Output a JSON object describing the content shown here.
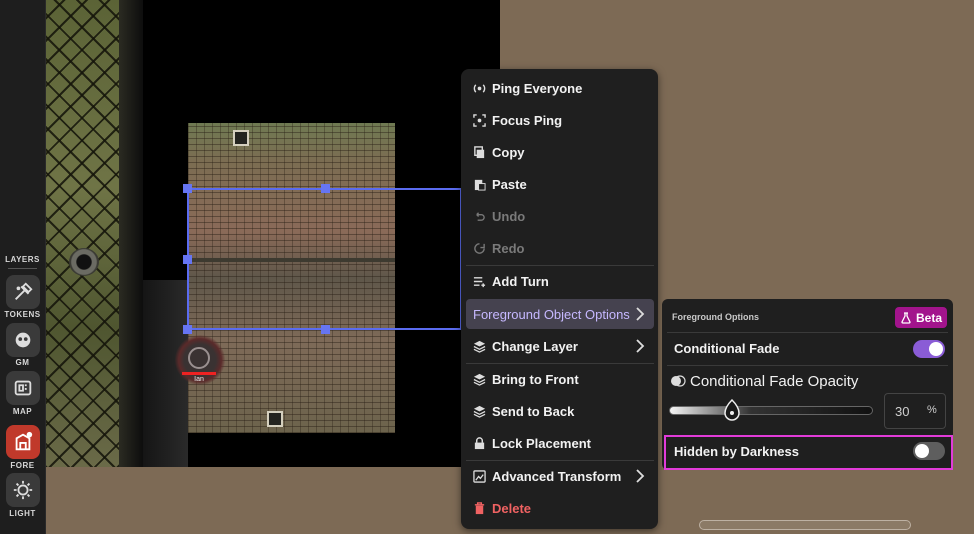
{
  "toolbar": {
    "section_title": "LAYERS",
    "layers": [
      {
        "label": "TOKENS",
        "icon": "tokens-icon"
      },
      {
        "label": "GM",
        "icon": "gm-icon"
      },
      {
        "label": "MAP",
        "icon": "map-icon"
      },
      {
        "label": "FORE",
        "icon": "foreground-icon",
        "active": true
      },
      {
        "label": "LIGHT",
        "icon": "light-icon"
      }
    ]
  },
  "map": {
    "token_name": "Ian"
  },
  "context_menu": {
    "items": [
      {
        "label": "Ping Everyone",
        "icon": "ping-icon"
      },
      {
        "label": "Focus Ping",
        "icon": "focus-ping-icon"
      },
      {
        "label": "Copy",
        "icon": "copy-icon"
      },
      {
        "label": "Paste",
        "icon": "paste-icon"
      },
      {
        "label": "Undo",
        "icon": "undo-icon",
        "disabled": true
      },
      {
        "label": "Redo",
        "icon": "redo-icon",
        "disabled": true
      },
      {
        "label": "Add Turn",
        "icon": "add-turn-icon"
      },
      {
        "label": "Foreground Object Options",
        "submenu": true,
        "highlighted": true
      },
      {
        "label": "Change Layer",
        "icon": "layers-icon",
        "submenu": true
      },
      {
        "label": "Bring to Front",
        "icon": "layers-icon"
      },
      {
        "label": "Send to Back",
        "icon": "layers-icon"
      },
      {
        "label": "Lock Placement",
        "icon": "lock-icon"
      },
      {
        "label": "Advanced Transform",
        "icon": "transform-icon",
        "submenu": true
      },
      {
        "label": "Delete",
        "icon": "trash-icon",
        "danger": true
      }
    ]
  },
  "foreground_options": {
    "title": "Foreground Options",
    "badge": "Beta",
    "conditional_fade": {
      "label": "Conditional Fade",
      "enabled": true
    },
    "fade_opacity": {
      "label": "Conditional Fade Opacity",
      "value": "30",
      "unit": "%",
      "level": 0.3
    },
    "hidden_by_darkness": {
      "label": "Hidden by Darkness",
      "enabled": false
    }
  },
  "colors": {
    "accent": "#8a5cd6",
    "badge": "#a2148c",
    "danger": "#f06262",
    "highlight_outline": "#e23bd9",
    "selection": "#5b6cf0"
  }
}
